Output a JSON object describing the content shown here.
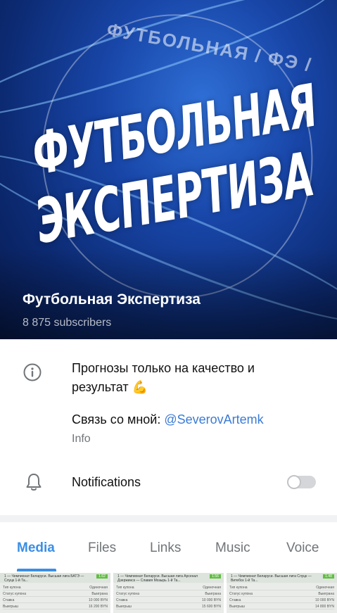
{
  "header": {
    "art_line1": "ФУТБОЛЬНАЯ",
    "art_line2": "ЭКСПЕРТИЗА",
    "ring_text": "ФУТБОЛЬНАЯ / ФЭ /",
    "title": "Футбольная Экспертиза",
    "subscribers": "8 875 subscribers"
  },
  "info": {
    "description": "Прогнозы только на качество и результат 💪",
    "contact_prefix": "Связь со мной: ",
    "contact_link": "@SeverovArtemk",
    "label": "Info"
  },
  "notifications": {
    "label": "Notifications",
    "enabled": false
  },
  "tabs": [
    {
      "label": "Media",
      "active": true
    },
    {
      "label": "Files",
      "active": false
    },
    {
      "label": "Links",
      "active": false
    },
    {
      "label": "Music",
      "active": false
    },
    {
      "label": "Voice",
      "active": false
    }
  ],
  "media_thumbs": [
    {
      "title": "1 — Чемпионат Беларуси. Высшая лига БАТЭ — Слуцк 1-й Та...",
      "odd": "1.62",
      "rows": [
        [
          "Тип купона",
          "Одиночная"
        ],
        [
          "Статус купона",
          "Выиграна"
        ],
        [
          "Ставка",
          "10 000 BYN"
        ],
        [
          "Выигрыш",
          "16 200 BYN"
        ]
      ]
    },
    {
      "title": "1 — Чемпионат Беларуси. Высшая лига Арсенал Дзержинск — Славия Мозырь 1-й Та...",
      "odd": "1.56",
      "rows": [
        [
          "Тип купона",
          "Одиночная"
        ],
        [
          "Статус купона",
          "Выиграна"
        ],
        [
          "Ставка",
          "10 000 BYN"
        ],
        [
          "Выигрыш",
          "15 600 BYN"
        ]
      ]
    },
    {
      "title": "1 — Чемпионат Беларуси. Высшая лига Слуцк — Витебск 1-й Та...",
      "odd": "1.48",
      "rows": [
        [
          "Тип купона",
          "Одиночная"
        ],
        [
          "Статус купона",
          "Выиграна"
        ],
        [
          "Ставка",
          "10 000 BYN"
        ],
        [
          "Выигрыш",
          "14 800 BYN"
        ]
      ]
    }
  ],
  "colors": {
    "accent": "#3a8ee6",
    "link": "#3a7bd5",
    "header_bg": "#1846a8",
    "secondary_text": "#707579"
  },
  "icons": {
    "info": "info-circle-icon",
    "notifications": "bell-icon"
  }
}
